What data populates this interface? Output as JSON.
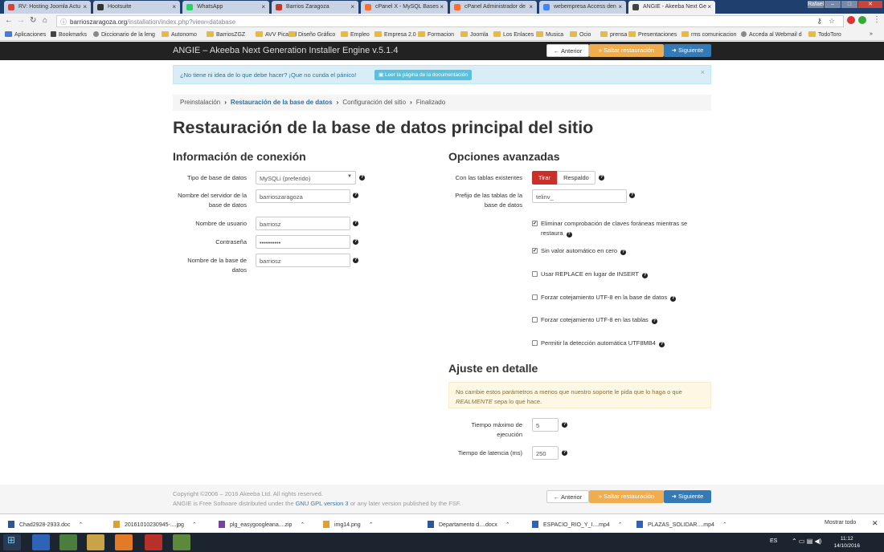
{
  "browser": {
    "tabs": [
      {
        "title": "RV: Hosting Joomla Actu",
        "color": "#d44638"
      },
      {
        "title": "Hootsuite",
        "color": "#333333"
      },
      {
        "title": "WhatsApp",
        "color": "#25d366"
      },
      {
        "title": "Barrios Zaragoza",
        "color": "#c0392b"
      },
      {
        "title": "cPanel X - MySQL Bases",
        "color": "#ff6c2c"
      },
      {
        "title": "cPanel Administrador de",
        "color": "#ff6c2c"
      },
      {
        "title": "webempresa Access den",
        "color": "#4285f4"
      },
      {
        "title": "ANGIE - Akeeba Next Ge",
        "color": "#444444"
      }
    ],
    "user_label": "Rafael",
    "url_domain": "barrioszaragoza.org",
    "url_path": "/installation/index.php?view=database",
    "bookmarks": [
      "Aplicaciones",
      "Bookmarks",
      "Diccionario de la leng",
      "Autonomo",
      "BarriosZGZ",
      "AVV Picarral",
      "Diseño Gráfico",
      "Empleo",
      "Empresa 2.0",
      "Formacion",
      "Joomla",
      "Los Enlaces",
      "Musica",
      "Ocio",
      "prensa",
      "Presentaciones",
      "rms comunicacion",
      "Acceda al Webmail d",
      "TodoToro"
    ]
  },
  "header": {
    "title": "ANGIE – Akeeba Next Generation Installer Engine v.5.1.4",
    "prev": "← Anterior",
    "skip": "» Saltar restauración",
    "next": "➜ Siguiente"
  },
  "alert": {
    "text": "¿No tiene ni idea de lo que debe hacer? ¡Que no cunda el pánico!",
    "button": "Leer la página de la documentación"
  },
  "breadcrumb": [
    "Preinstalación",
    "Restauración de la base de datos",
    "Configuración del sitio",
    "Finalizado"
  ],
  "page_title": "Restauración de la base de datos principal del sitio",
  "connection": {
    "heading": "Información de conexión",
    "db_type_label": "Tipo de base de datos",
    "db_type_value": "MySQLi (preferido)",
    "server_label": "Nombre del servidor de la base de datos",
    "server_value": "barrioszaragoza",
    "user_label": "Nombre de usuario",
    "user_value": "barriosz",
    "password_label": "Contraseña",
    "password_value": "••••••••••",
    "dbname_label": "Nombre de la base de datos",
    "dbname_value": "barriosz"
  },
  "advanced": {
    "heading": "Opciones avanzadas",
    "existing_label": "Con las tablas existentes",
    "drop_btn": "Tirar",
    "backup_btn": "Respaldo",
    "prefix_label": "Prefijo de las tablas de la base de datos",
    "prefix_value": "telinv_",
    "options": [
      {
        "label": "Eliminar comprobación de claves foráneas mientras se restaura",
        "checked": true
      },
      {
        "label": "Sin valor automático en cero",
        "checked": true
      },
      {
        "label": "Usar REPLACE en lugar de INSERT",
        "checked": false
      },
      {
        "label": "Forzar cotejamiento UTF-8 en la base de datos",
        "checked": false
      },
      {
        "label": "Forzar cotejamiento UTF-8 en las tablas",
        "checked": false
      },
      {
        "label": "Permitir la detección automática UTF8MB4",
        "checked": false
      }
    ]
  },
  "finetune": {
    "heading": "Ajuste en detalle",
    "warning_pre": "No cambie estos parámetros a menos que nuestro soporte le pida que lo haga o que",
    "warning_em": "REALMENTE",
    "warning_post": "sepa lo que hace.",
    "max_exec_label": "Tiempo máximo de ejecución",
    "max_exec_value": "5",
    "latency_label": "Tiempo de latencia (ms)",
    "latency_value": "250"
  },
  "footer": {
    "copyright": "Copyright ©2006 – 2016 Akeeba Ltd. All rights reserved.",
    "license_pre": "ANGIE is Free Software distributed under the",
    "license_link": "GNU GPL version 3",
    "license_post": "or any later version published by the FSF."
  },
  "downloads": {
    "items": [
      "Chad2928-2933.doc",
      "20161010230945-....jpg",
      "plg_easygoogleana....zip",
      "img14.png",
      "Departamento d....docx",
      "ESPACIO_RIO_Y_I....mp4",
      "PLAZAS_SOLIDAR....mp4"
    ],
    "show_all": "Mostrar todo"
  },
  "taskbar": {
    "lang": "ES",
    "time": "11:12",
    "date": "14/10/2016"
  }
}
